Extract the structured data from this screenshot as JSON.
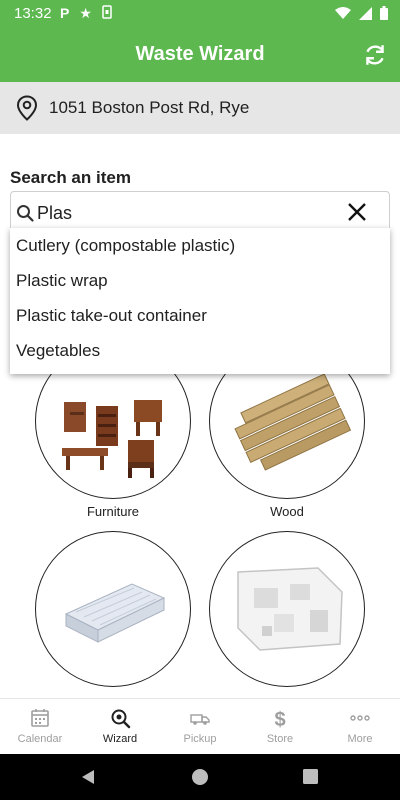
{
  "status_bar": {
    "time": "13:32",
    "left_icons": [
      "p-icon",
      "star-icon",
      "sim-icon"
    ],
    "right_icons": [
      "wifi-icon",
      "signal-icon",
      "battery-icon"
    ]
  },
  "app_bar": {
    "title": "Waste Wizard",
    "action_icon": "refresh-icon",
    "color": "#5cb84f"
  },
  "address": {
    "icon": "location-pin-icon",
    "text": "1051 Boston Post Rd, Rye"
  },
  "search": {
    "label": "Search an item",
    "value": "Plas"
  },
  "suggestions": [
    "Cutlery (compostable plastic)",
    "Plastic wrap",
    "Plastic take-out container",
    "Vegetables"
  ],
  "categories": [
    {
      "label": "Furniture"
    },
    {
      "label": "Wood"
    },
    {
      "label": ""
    },
    {
      "label": ""
    }
  ],
  "bottom_nav": [
    {
      "label": "Calendar",
      "icon": "calendar-icon",
      "active": false
    },
    {
      "label": "Wizard",
      "icon": "wizard-search-icon",
      "active": true
    },
    {
      "label": "Pickup",
      "icon": "truck-icon",
      "active": false
    },
    {
      "label": "Store",
      "icon": "dollar-icon",
      "active": false
    },
    {
      "label": "More",
      "icon": "more-dots-icon",
      "active": false
    }
  ]
}
